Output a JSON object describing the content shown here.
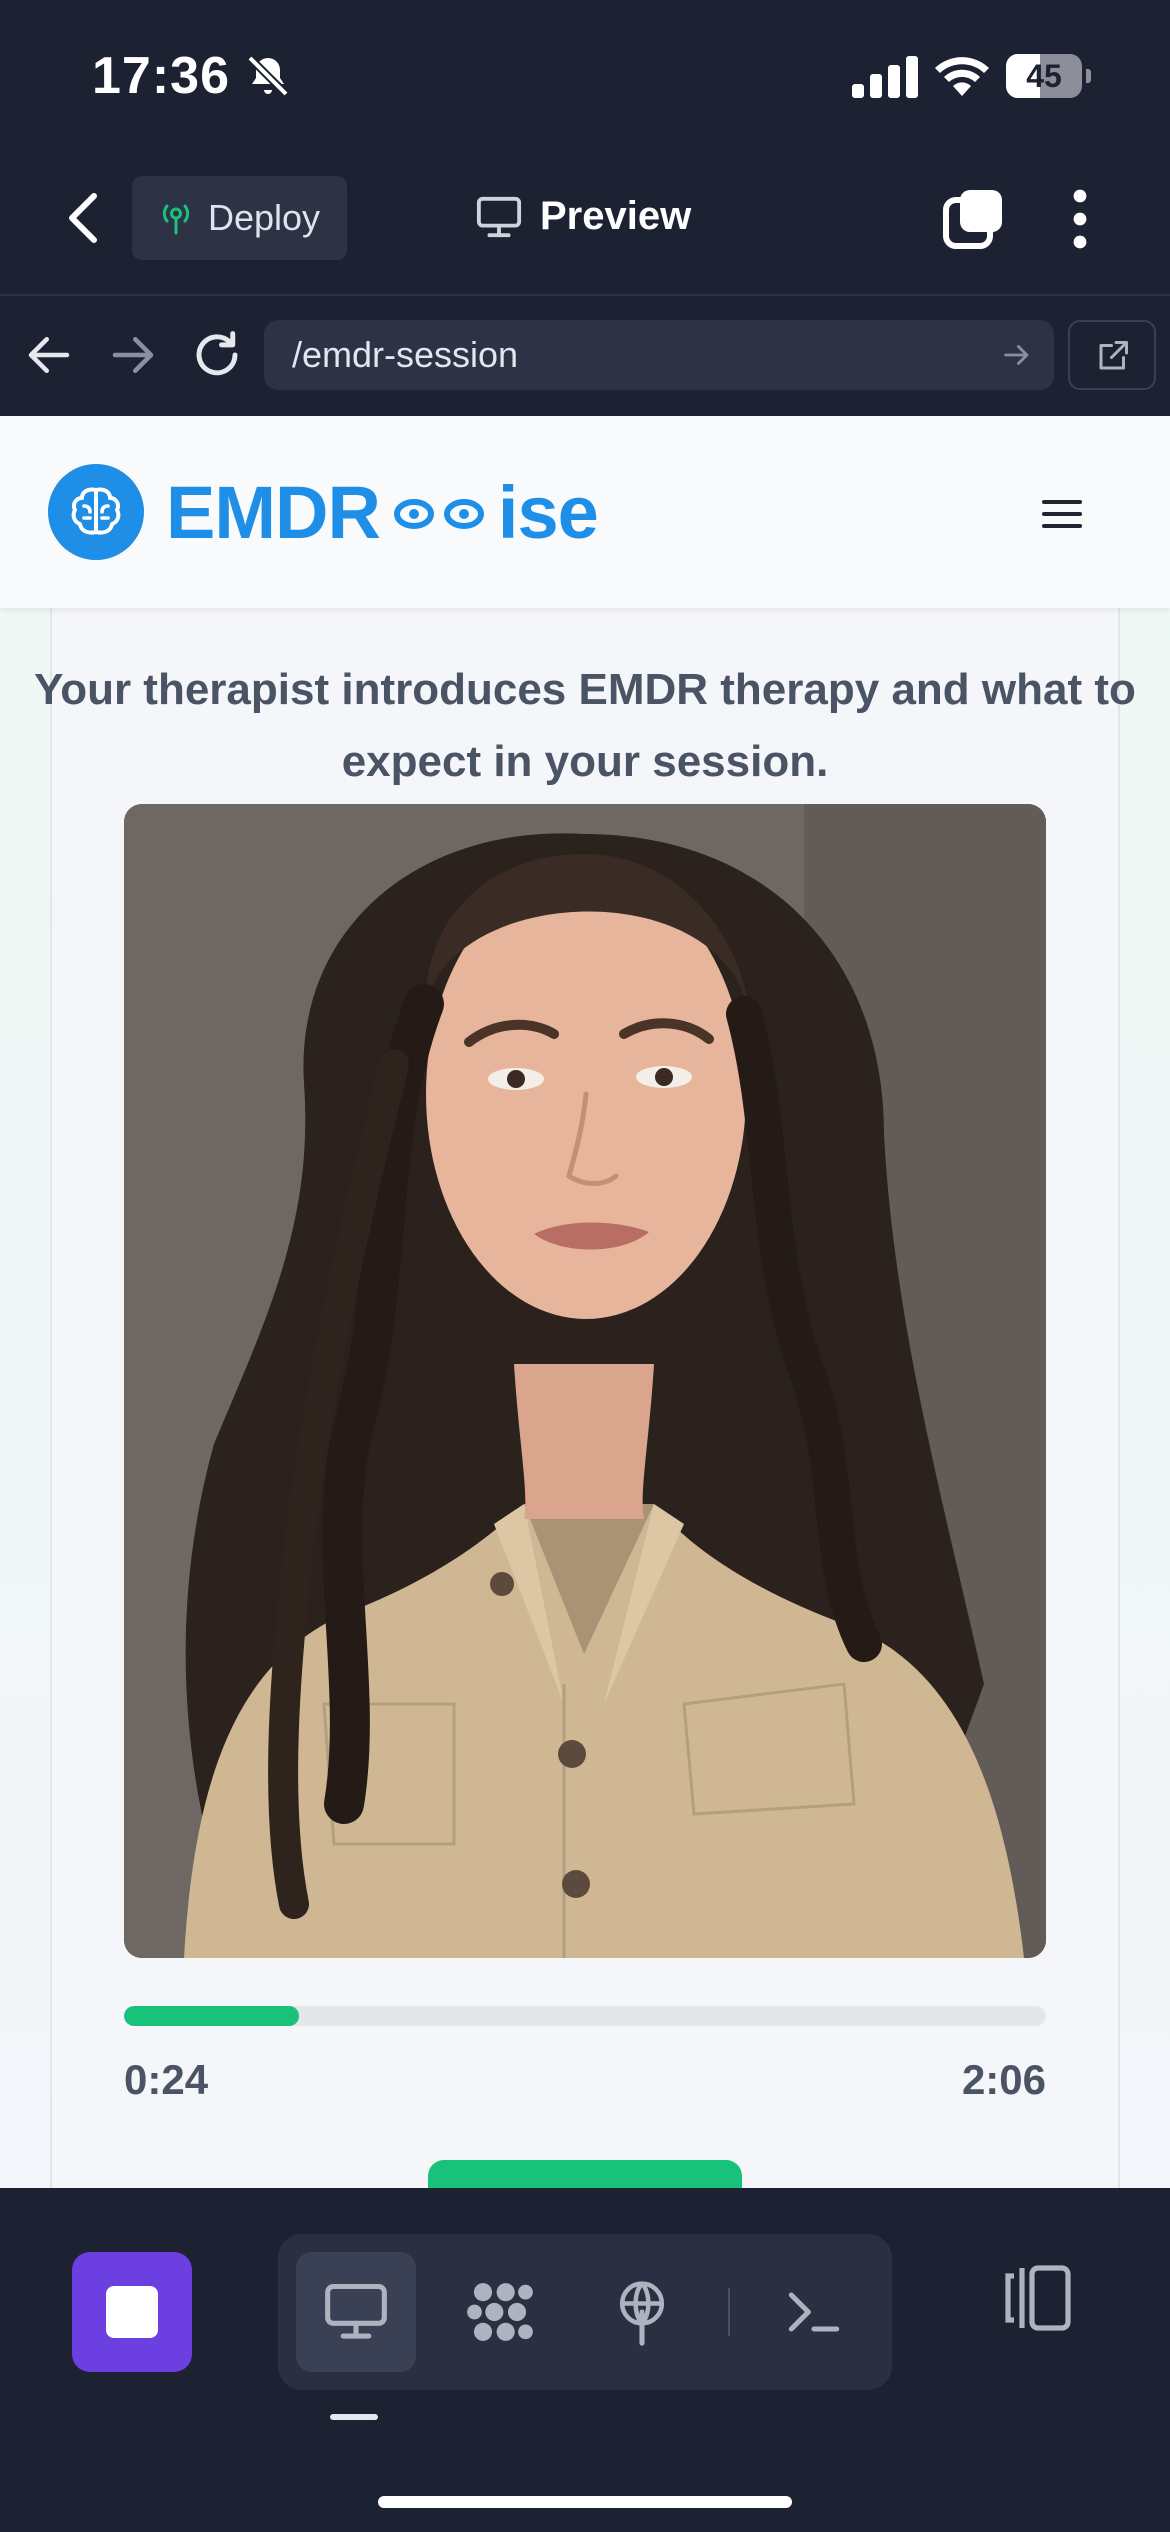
{
  "status_bar": {
    "time": "17:36",
    "battery_level": "45",
    "battery_fraction": 0.45
  },
  "ide": {
    "back_icon": "chevron-left-icon",
    "deploy_label": "Deploy",
    "deploy_icon": "antenna-icon",
    "preview_label": "Preview",
    "preview_icon": "monitor-icon",
    "tabs_icon": "tabs-icon",
    "more_icon": "vertical-dots-icon"
  },
  "browser": {
    "url": "/emdr-session",
    "back_icon": "arrow-left-icon",
    "forward_icon": "arrow-right-icon",
    "reload_icon": "reload-icon",
    "open_external_icon": "external-link-icon"
  },
  "site": {
    "logo_icon": "brain-icon",
    "brand_prefix": "EMDR",
    "brand_suffix": "ise",
    "menu_icon": "hamburger-menu-icon",
    "brand_color": "#1e8ee6"
  },
  "session": {
    "description": "Your therapist introduces EMDR therapy and what to expect in your session.",
    "video_subject": "therapist-video",
    "current_time": "0:24",
    "total_time": "2:06",
    "progress_fraction": 0.19,
    "accent_color": "#19c27a"
  },
  "toolbar": {
    "stop_icon": "stop-icon",
    "tools": [
      {
        "icon": "monitor-icon",
        "active": true
      },
      {
        "icon": "workflow-icon",
        "active": false
      },
      {
        "icon": "antenna-icon",
        "active": false
      },
      {
        "icon": "terminal-icon",
        "active": false
      }
    ],
    "panel_icon": "split-panel-icon"
  }
}
